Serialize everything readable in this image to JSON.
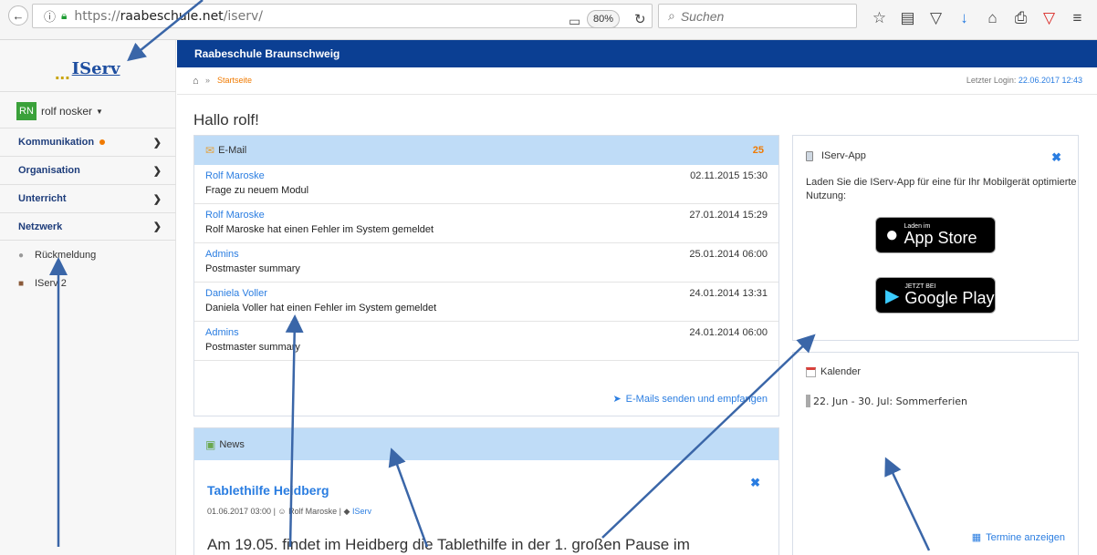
{
  "browser": {
    "url_prefix": "https://",
    "url_domain": "raabeschule.net",
    "url_path": "/iserv/",
    "zoom": "80%",
    "search_placeholder": "Suchen"
  },
  "sidebar": {
    "logo_dots": "...",
    "logo_text": "IServ",
    "user_initials": "RN",
    "user_name": "rolf nosker",
    "nav": [
      {
        "label": "Kommunikation",
        "badge": true
      },
      {
        "label": "Organisation"
      },
      {
        "label": "Unterricht"
      },
      {
        "label": "Netzwerk"
      }
    ],
    "feedback_label": "Rückmeldung",
    "iserv2_label": "IServ 2"
  },
  "header": {
    "school_title": "Raabeschule Braunschweig",
    "breadcrumb_sep": "»",
    "breadcrumb_link": "Startseite",
    "last_login_label": "Letzter Login:",
    "last_login_value": "22.06.2017 12:43"
  },
  "greeting": "Hallo rolf!",
  "email": {
    "title": "E-Mail",
    "count": "25",
    "rows": [
      {
        "from": "Rolf Maroske",
        "date": "02.11.2015 15:30",
        "subject": "Frage zu neuem Modul"
      },
      {
        "from": "Rolf Maroske",
        "date": "27.01.2014 15:29",
        "subject": "Rolf Maroske hat einen Fehler im System gemeldet"
      },
      {
        "from": "Admins",
        "date": "25.01.2014 06:00",
        "subject": "Postmaster summary"
      },
      {
        "from": "Daniela Voller",
        "date": "24.01.2014 13:31",
        "subject": "Daniela Voller hat einen Fehler im System gemeldet"
      },
      {
        "from": "Admins",
        "date": "24.01.2014 06:00",
        "subject": "Postmaster summary"
      }
    ],
    "footer_link": "E-Mails senden und empfangen"
  },
  "news": {
    "title": "News",
    "item_title": "Tablethilfe Heidberg",
    "item_date": "01.06.2017 03:00 |",
    "item_author": "Rolf Maroske",
    "item_sep": "|",
    "item_tag": "IServ",
    "item_body": "Am 19.05. findet im Heidberg die Tablethilfe in der 1. großen Pause im"
  },
  "app": {
    "title": "IServ-App",
    "text": "Laden Sie die IServ-App für eine für Ihr Mobilgerät optimierte Nutzung:",
    "appstore_small": "Laden im",
    "appstore_big": "App Store",
    "play_small": "JETZT BEI",
    "play_big": "Google Play"
  },
  "calendar": {
    "title": "Kalender",
    "event": "22. Jun - 30. Jul: Sommerferien",
    "footer_link": "Termine anzeigen"
  },
  "colors": {
    "topbar": "#0b3f93",
    "panel_head": "#bfdcf7",
    "link": "#2a7de1",
    "accent": "#f07a00",
    "arrow": "#3a66a8"
  }
}
